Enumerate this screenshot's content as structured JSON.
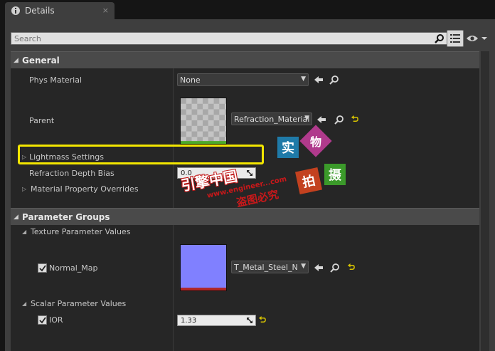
{
  "tab": {
    "title": "Details",
    "close_glyph": "×"
  },
  "search": {
    "placeholder": "Search"
  },
  "general": {
    "title": "General",
    "phys_material": {
      "label": "Phys Material",
      "value": "None"
    },
    "parent": {
      "label": "Parent",
      "value": "Refraction_Material"
    },
    "lightmass": {
      "label": "Lightmass Settings"
    },
    "refraction_depth_bias": {
      "label": "Refraction Depth Bias",
      "value": "0.0"
    },
    "material_property_overrides": {
      "label": "Material Property Overrides"
    }
  },
  "parameter_groups": {
    "title": "Parameter Groups",
    "texture_parameter_values": {
      "label": "Texture Parameter Values"
    },
    "normal_map": {
      "label": "Normal_Map",
      "value": "T_Metal_Steel_N",
      "checked": true
    },
    "scalar_parameter_values": {
      "label": "Scalar Parameter Values"
    },
    "ior": {
      "label": "IOR",
      "value": "1.33",
      "checked": true
    }
  },
  "watermark": {
    "stamp_1": "实",
    "stamp_2": "物",
    "stamp_3": "拍",
    "stamp_4": "摄",
    "brand": "引擎中国",
    "url": "www.engineer...com",
    "notice": "盗图必究"
  },
  "colors": {
    "highlight": "#f3e600",
    "normal_map_swatch": "#8080ff",
    "accent_yellow": "#d8c400"
  }
}
